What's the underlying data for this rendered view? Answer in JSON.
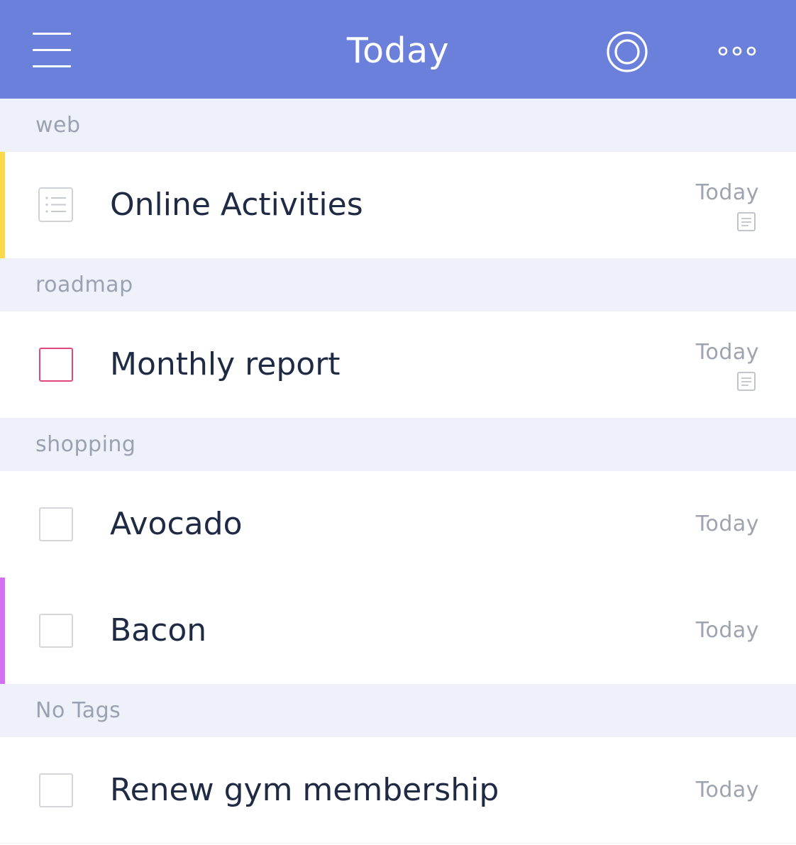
{
  "header": {
    "title": "Today",
    "menu_icon": "hamburger-menu-icon",
    "focus_icon": "target-icon",
    "more_icon": "more-horizontal-icon",
    "background_color": "#6a80da"
  },
  "sections": [
    {
      "label": "web",
      "tasks": [
        {
          "title": "Online Activities",
          "date": "Today",
          "type": "checklist",
          "has_note": true,
          "tag_color": "#fcd94a"
        }
      ]
    },
    {
      "label": "roadmap",
      "tasks": [
        {
          "title": "Monthly report",
          "date": "Today",
          "type": "task",
          "priority": true,
          "priority_color": "#e0477e",
          "has_note": true
        }
      ]
    },
    {
      "label": "shopping",
      "tasks": [
        {
          "title": "Avocado",
          "date": "Today",
          "type": "task",
          "has_note": false
        },
        {
          "title": "Bacon",
          "date": "Today",
          "type": "task",
          "has_note": false,
          "tag_color": "#d26ff2"
        }
      ]
    },
    {
      "label": "No Tags",
      "tasks": [
        {
          "title": "Renew gym membership",
          "date": "Today",
          "type": "task",
          "has_note": false
        }
      ]
    }
  ]
}
